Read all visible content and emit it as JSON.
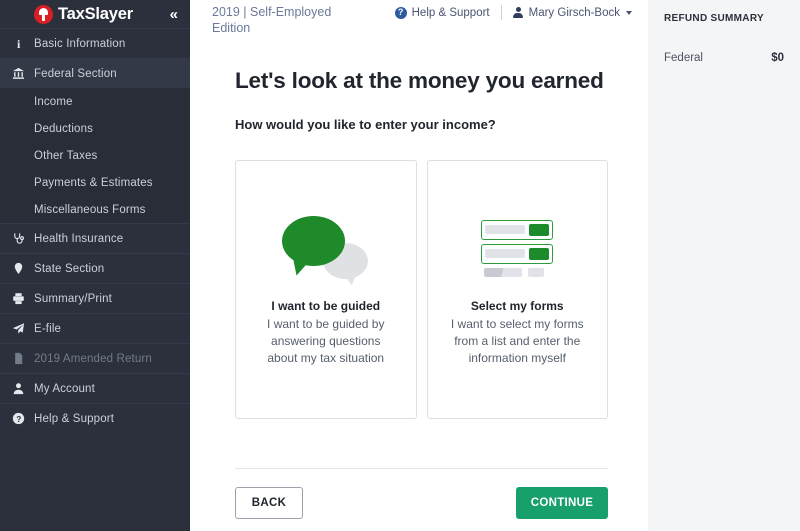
{
  "sidebar": {
    "brand": "TaxSlayer",
    "logo_icon": "taxslayer-helmet-logo",
    "collapse_icon": "«",
    "items": [
      {
        "label": "Basic Information",
        "icon": "info-icon",
        "glyph": "i",
        "state": "normal"
      },
      {
        "label": "Federal Section",
        "icon": "bank-icon",
        "glyph": "\u0001",
        "state": "active"
      },
      {
        "label": "Health Insurance",
        "icon": "stethoscope-icon",
        "glyph": "\u0002",
        "state": "normal"
      },
      {
        "label": "State Section",
        "icon": "map-pin-icon",
        "glyph": "\u0003",
        "state": "normal"
      },
      {
        "label": "Summary/Print",
        "icon": "printer-icon",
        "glyph": "\u0004",
        "state": "normal"
      },
      {
        "label": "E-file",
        "icon": "paper-plane-icon",
        "glyph": "\u0005",
        "state": "normal"
      },
      {
        "label": "2019 Amended Return",
        "icon": "document-icon",
        "glyph": "\u0006",
        "state": "disabled"
      },
      {
        "label": "My Account",
        "icon": "person-icon",
        "glyph": "\u0007",
        "state": "normal"
      },
      {
        "label": "Help & Support",
        "icon": "question-circle-icon",
        "glyph": "?",
        "state": "normal"
      }
    ],
    "federal_subitems": [
      {
        "label": "Income"
      },
      {
        "label": "Deductions"
      },
      {
        "label": "Other Taxes"
      },
      {
        "label": "Payments & Estimates"
      },
      {
        "label": "Miscellaneous Forms"
      }
    ]
  },
  "topbar": {
    "edition": "2019 | Self-Employed Edition",
    "help_label": "Help & Support",
    "help_icon": "question-mark-circle-icon",
    "user_name": "Mary Girsch-Bock",
    "user_icon": "user-avatar-icon",
    "caret_icon": "chevron-down-icon"
  },
  "main": {
    "title": "Let's look at the money you earned",
    "subtitle": "How would you like to enter your income?",
    "cards": [
      {
        "icon": "speech-bubbles-icon",
        "title": "I want to be guided",
        "description": "I want to be guided by answering questions about my tax situation"
      },
      {
        "icon": "forms-list-icon",
        "title": "Select my forms",
        "description": "I want to select my forms from a list and enter the information myself"
      }
    ],
    "back_label": "BACK",
    "continue_label": "CONTINUE"
  },
  "refund": {
    "title": "REFUND SUMMARY",
    "rows": [
      {
        "label": "Federal",
        "value": "$0"
      }
    ]
  },
  "colors": {
    "sidebar_bg": "#2b303c",
    "submenu_bg": "#282d38",
    "brand_red": "#d81f26",
    "accent_green": "#17a06c",
    "icon_green": "#1e8a2a",
    "panel_bg": "#f4f5f7",
    "header_text": "#6b7a99"
  }
}
